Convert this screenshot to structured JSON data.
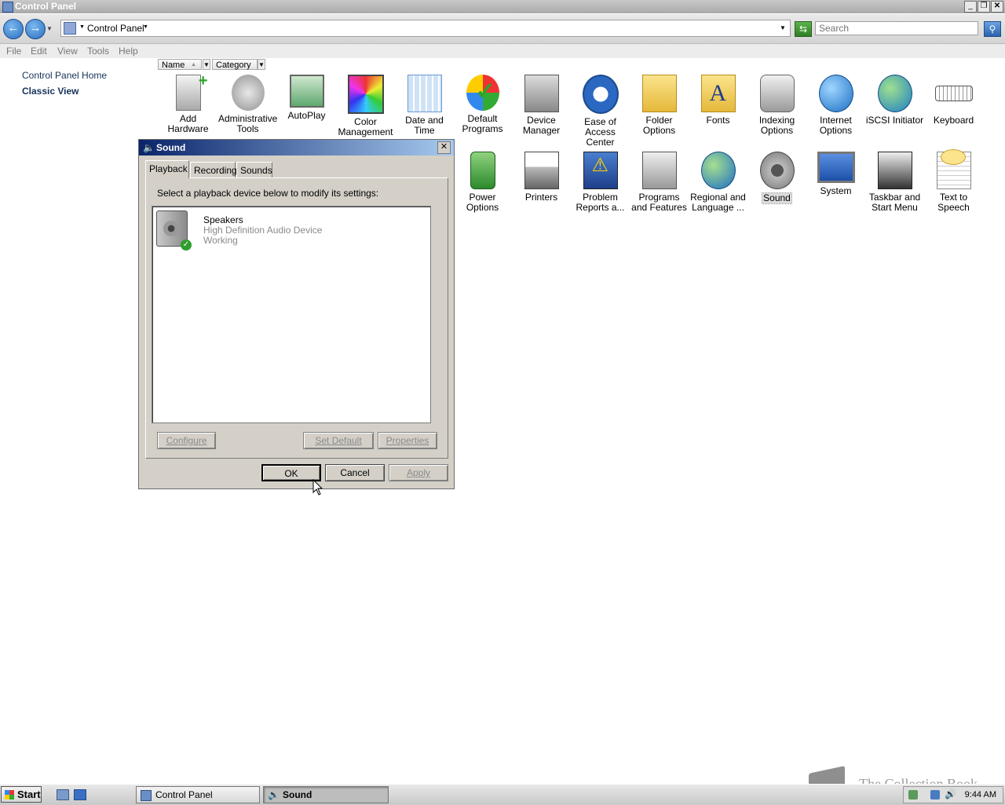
{
  "window": {
    "title": "Control Panel"
  },
  "address": {
    "path": "Control Panel",
    "search_placeholder": "Search"
  },
  "menu": [
    "File",
    "Edit",
    "View",
    "Tools",
    "Help"
  ],
  "left_pane": {
    "home": "Control Panel Home",
    "classic": "Classic View"
  },
  "columns": {
    "name": "Name",
    "category": "Category"
  },
  "items_row1": [
    {
      "label": "Add Hardware",
      "icon": "add-hardware-icon"
    },
    {
      "label": "Administrative Tools",
      "icon": "administrative-tools-icon"
    },
    {
      "label": "AutoPlay",
      "icon": "autoplay-icon"
    },
    {
      "label": "Color Management",
      "icon": "color-management-icon"
    },
    {
      "label": "Date and Time",
      "icon": "date-time-icon"
    },
    {
      "label": "Default Programs",
      "icon": "default-programs-icon"
    },
    {
      "label": "Device Manager",
      "icon": "device-manager-icon"
    },
    {
      "label": "Ease of Access Center",
      "icon": "ease-of-access-icon"
    },
    {
      "label": "Folder Options",
      "icon": "folder-options-icon"
    },
    {
      "label": "Fonts",
      "icon": "fonts-icon"
    },
    {
      "label": "Indexing Options",
      "icon": "indexing-options-icon"
    },
    {
      "label": "Internet Options",
      "icon": "internet-options-icon"
    },
    {
      "label": "iSCSI Initiator",
      "icon": "iscsi-initiator-icon"
    },
    {
      "label": "Keyboard",
      "icon": "keyboard-icon"
    }
  ],
  "items_row2": [
    {
      "label": "Power Options",
      "icon": "power-options-icon"
    },
    {
      "label": "Printers",
      "icon": "printers-icon"
    },
    {
      "label": "Problem Reports a...",
      "icon": "problem-reports-icon"
    },
    {
      "label": "Programs and Features",
      "icon": "programs-features-icon"
    },
    {
      "label": "Regional and Language ...",
      "icon": "regional-language-icon"
    },
    {
      "label": "Sound",
      "icon": "sound-icon"
    },
    {
      "label": "System",
      "icon": "system-icon"
    },
    {
      "label": "Taskbar and Start Menu",
      "icon": "taskbar-start-menu-icon"
    },
    {
      "label": "Text to Speech",
      "icon": "text-to-speech-icon"
    }
  ],
  "dialog": {
    "title": "Sound",
    "tabs": [
      "Playback",
      "Recording",
      "Sounds"
    ],
    "instruction": "Select a playback device below to modify its settings:",
    "device": {
      "name": "Speakers",
      "driver": "High Definition Audio Device",
      "status": "Working"
    },
    "buttons": {
      "configure": "Configure",
      "set_default": "Set Default",
      "properties": "Properties",
      "ok": "OK",
      "cancel": "Cancel",
      "apply": "Apply"
    }
  },
  "taskbar": {
    "start": "Start",
    "task1": "Control Panel",
    "task2": "Sound",
    "clock": "9:44 AM"
  },
  "watermark": "The Collection Book"
}
